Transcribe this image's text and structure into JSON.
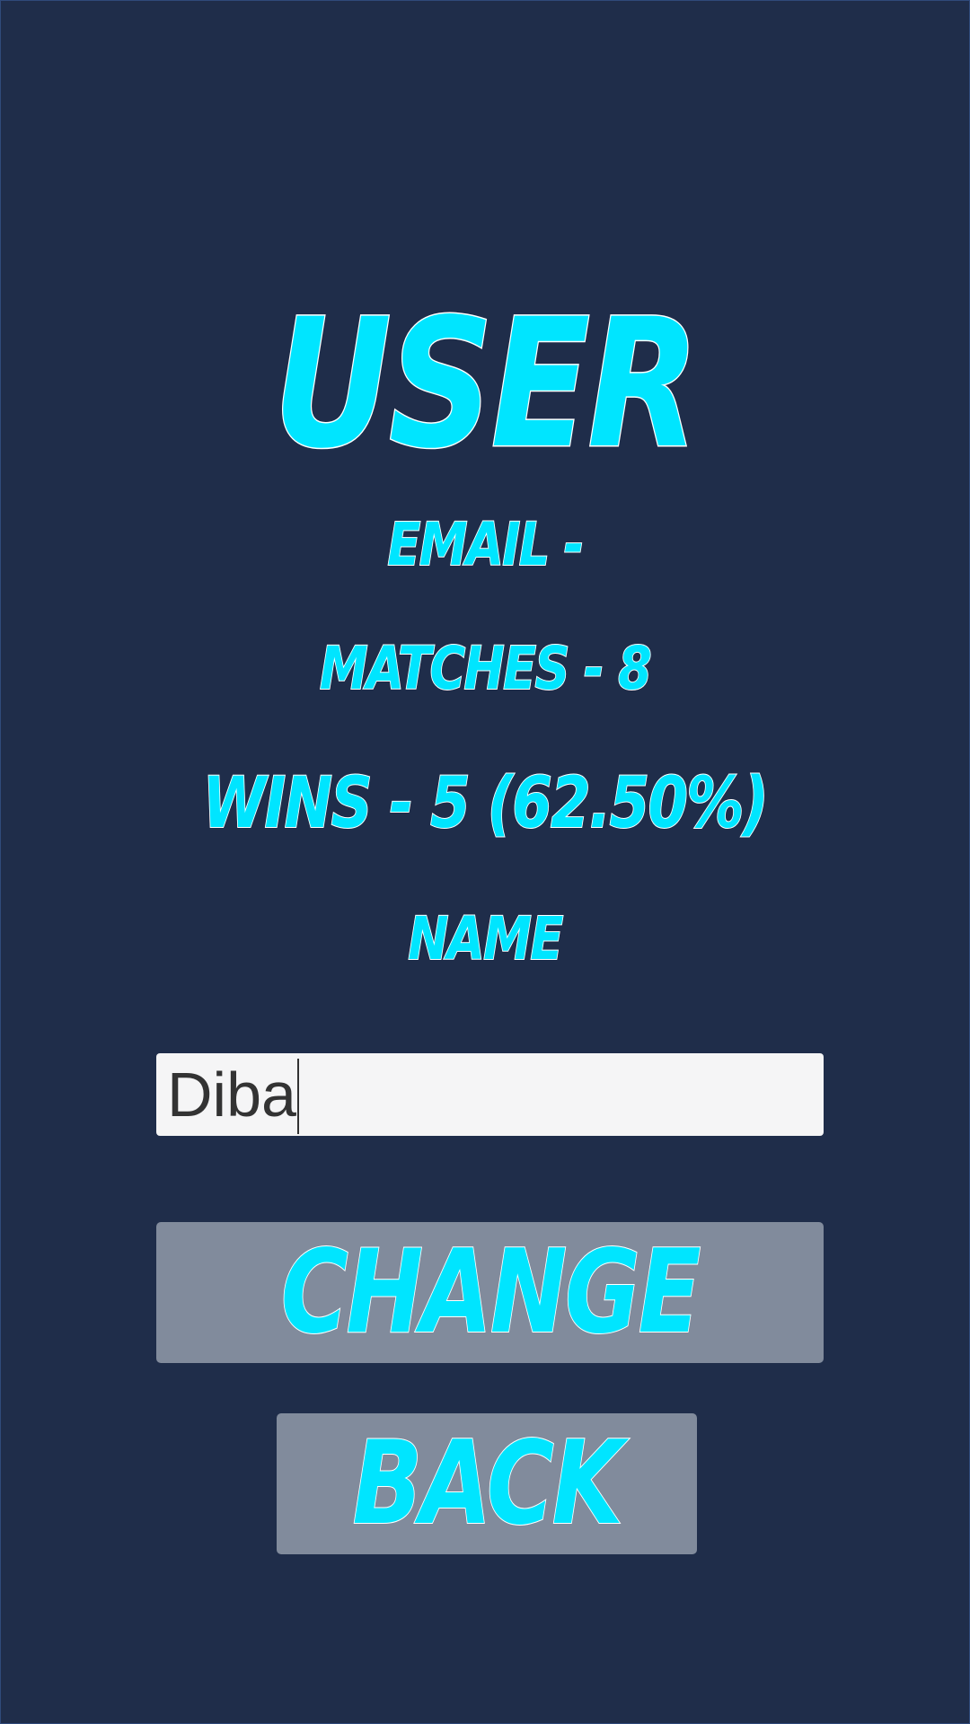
{
  "colors": {
    "background": "#1f2d4a",
    "accent_text": "#00e5ff",
    "text_outline": "#ffffff",
    "button_bg": "#818b9c",
    "input_bg": "#f5f5f6"
  },
  "header": {
    "title": "User"
  },
  "stats": {
    "email": "Email -",
    "matches": "Matches - 8",
    "wins": "Wins - 5 (62.50%)"
  },
  "name_section": {
    "label": "Name",
    "input_value": "Diba"
  },
  "buttons": {
    "change_label": "Change",
    "back_label": "Back"
  }
}
